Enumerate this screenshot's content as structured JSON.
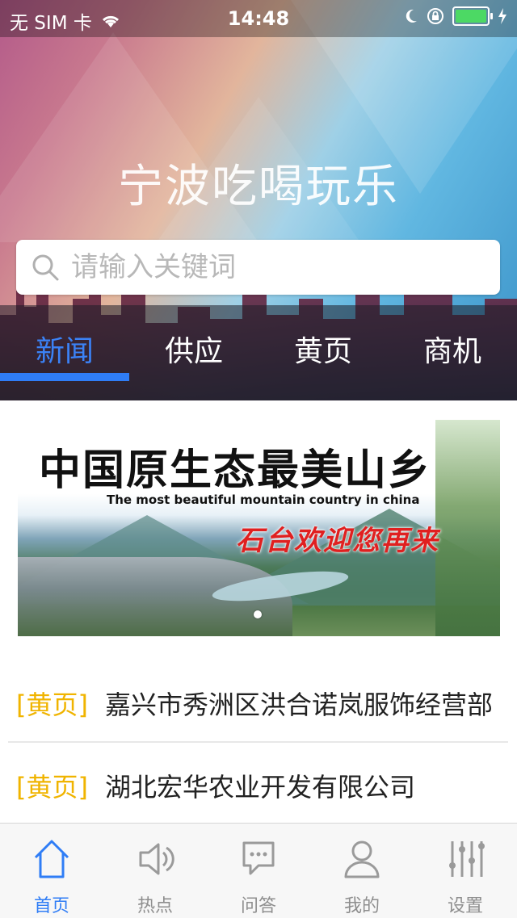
{
  "status_bar": {
    "carrier": "无 SIM 卡",
    "time": "14:48",
    "battery_color": "#4cd964"
  },
  "header": {
    "title": "宁波吃喝玩乐"
  },
  "search": {
    "placeholder": "请输入关键词",
    "icon": "search-icon"
  },
  "tabs": [
    {
      "label": "新闻",
      "active": true
    },
    {
      "label": "供应",
      "active": false
    },
    {
      "label": "黄页",
      "active": false
    },
    {
      "label": "商机",
      "active": false
    }
  ],
  "banner": {
    "headline": "中国原生态最美山乡",
    "subtitle_en": "The most beautiful mountain country in china",
    "welcome": "石台欢迎您再来"
  },
  "list": [
    {
      "tag": "[黄页]",
      "title": "嘉兴市秀洲区洪合诺岚服饰经营部"
    },
    {
      "tag": "[黄页]",
      "title": "湖北宏华农业开发有限公司"
    }
  ],
  "bottom_nav": [
    {
      "label": "首页",
      "icon": "home-icon",
      "active": true
    },
    {
      "label": "热点",
      "icon": "speaker-icon",
      "active": false
    },
    {
      "label": "问答",
      "icon": "chat-bubble-icon",
      "active": false
    },
    {
      "label": "我的",
      "icon": "user-icon",
      "active": false
    },
    {
      "label": "设置",
      "icon": "sliders-icon",
      "active": false
    }
  ],
  "colors": {
    "accent": "#2f7df6",
    "tag": "#f0b400",
    "welcome_red": "#e02020"
  }
}
